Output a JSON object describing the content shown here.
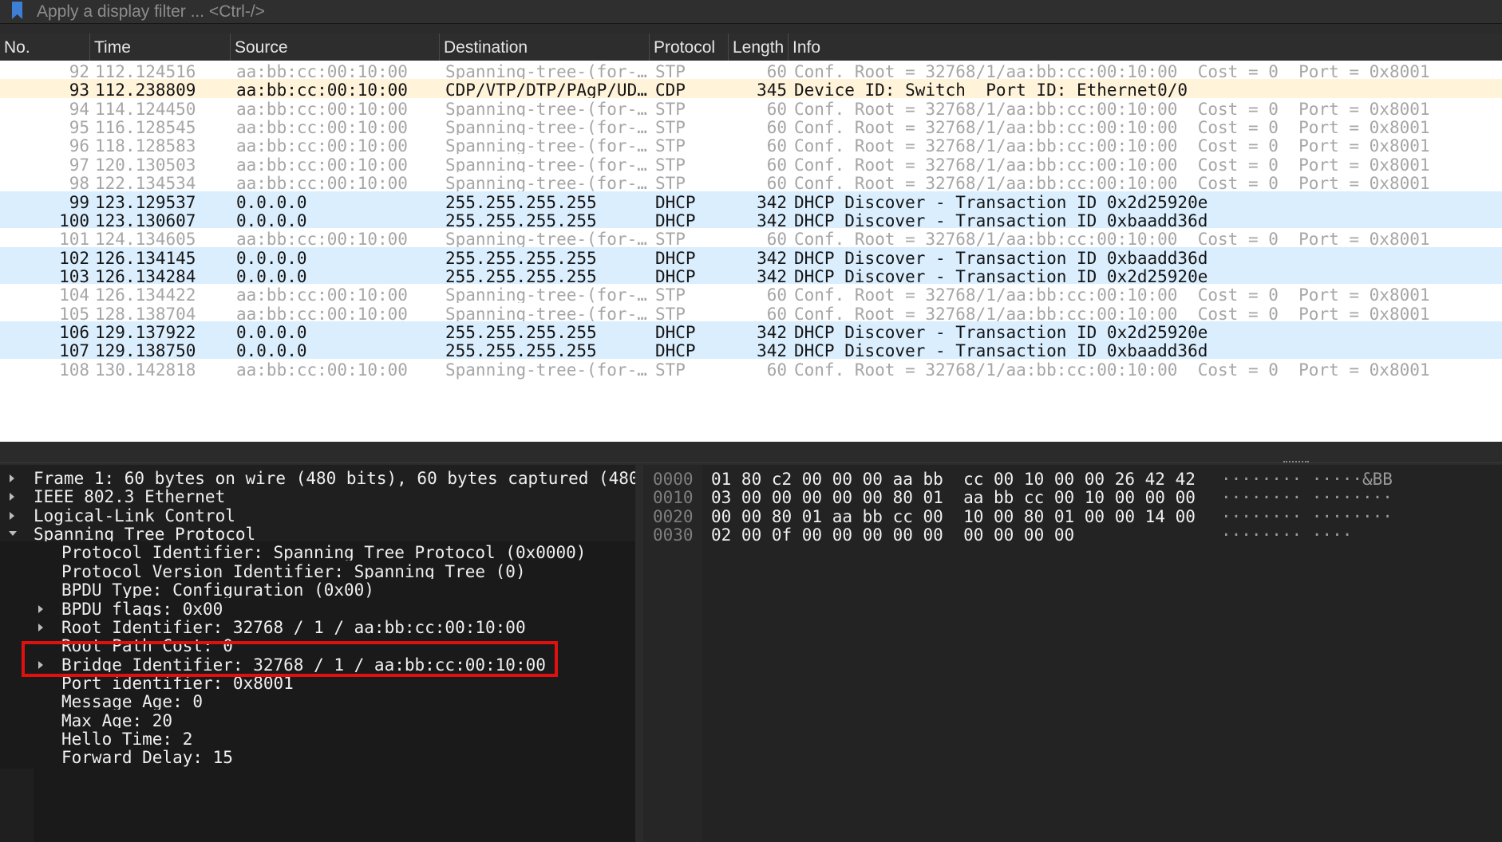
{
  "filter": {
    "placeholder": "Apply a display filter ... <Ctrl-/>"
  },
  "packet_list": {
    "columns": [
      "No.",
      "Time",
      "Source",
      "Destination",
      "Protocol",
      "Length",
      "Info"
    ],
    "rows": [
      {
        "no": "92",
        "time": "112.124516",
        "src": "aa:bb:cc:00:10:00",
        "dst": "Spanning-tree-(for-…",
        "proto": "STP",
        "len": "60",
        "info": "Conf. Root = 32768/1/aa:bb:cc:00:10:00  Cost = 0  Port = 0x8001",
        "kind": "stp"
      },
      {
        "no": "93",
        "time": "112.238809",
        "src": "aa:bb:cc:00:10:00",
        "dst": "CDP/VTP/DTP/PAgP/UD…",
        "proto": "CDP",
        "len": "345",
        "info": "Device ID: Switch  Port ID: Ethernet0/0",
        "kind": "cdp"
      },
      {
        "no": "94",
        "time": "114.124450",
        "src": "aa:bb:cc:00:10:00",
        "dst": "Spanning-tree-(for-…",
        "proto": "STP",
        "len": "60",
        "info": "Conf. Root = 32768/1/aa:bb:cc:00:10:00  Cost = 0  Port = 0x8001",
        "kind": "stp"
      },
      {
        "no": "95",
        "time": "116.128545",
        "src": "aa:bb:cc:00:10:00",
        "dst": "Spanning-tree-(for-…",
        "proto": "STP",
        "len": "60",
        "info": "Conf. Root = 32768/1/aa:bb:cc:00:10:00  Cost = 0  Port = 0x8001",
        "kind": "stp"
      },
      {
        "no": "96",
        "time": "118.128583",
        "src": "aa:bb:cc:00:10:00",
        "dst": "Spanning-tree-(for-…",
        "proto": "STP",
        "len": "60",
        "info": "Conf. Root = 32768/1/aa:bb:cc:00:10:00  Cost = 0  Port = 0x8001",
        "kind": "stp"
      },
      {
        "no": "97",
        "time": "120.130503",
        "src": "aa:bb:cc:00:10:00",
        "dst": "Spanning-tree-(for-…",
        "proto": "STP",
        "len": "60",
        "info": "Conf. Root = 32768/1/aa:bb:cc:00:10:00  Cost = 0  Port = 0x8001",
        "kind": "stp"
      },
      {
        "no": "98",
        "time": "122.134534",
        "src": "aa:bb:cc:00:10:00",
        "dst": "Spanning-tree-(for-…",
        "proto": "STP",
        "len": "60",
        "info": "Conf. Root = 32768/1/aa:bb:cc:00:10:00  Cost = 0  Port = 0x8001",
        "kind": "stp"
      },
      {
        "no": "99",
        "time": "123.129537",
        "src": "0.0.0.0",
        "dst": "255.255.255.255",
        "proto": "DHCP",
        "len": "342",
        "info": "DHCP Discover - Transaction ID 0x2d25920e",
        "kind": "dhcp"
      },
      {
        "no": "100",
        "time": "123.130607",
        "src": "0.0.0.0",
        "dst": "255.255.255.255",
        "proto": "DHCP",
        "len": "342",
        "info": "DHCP Discover - Transaction ID 0xbaadd36d",
        "kind": "dhcp"
      },
      {
        "no": "101",
        "time": "124.134605",
        "src": "aa:bb:cc:00:10:00",
        "dst": "Spanning-tree-(for-…",
        "proto": "STP",
        "len": "60",
        "info": "Conf. Root = 32768/1/aa:bb:cc:00:10:00  Cost = 0  Port = 0x8001",
        "kind": "stp"
      },
      {
        "no": "102",
        "time": "126.134145",
        "src": "0.0.0.0",
        "dst": "255.255.255.255",
        "proto": "DHCP",
        "len": "342",
        "info": "DHCP Discover - Transaction ID 0xbaadd36d",
        "kind": "dhcp"
      },
      {
        "no": "103",
        "time": "126.134284",
        "src": "0.0.0.0",
        "dst": "255.255.255.255",
        "proto": "DHCP",
        "len": "342",
        "info": "DHCP Discover - Transaction ID 0x2d25920e",
        "kind": "dhcp"
      },
      {
        "no": "104",
        "time": "126.134422",
        "src": "aa:bb:cc:00:10:00",
        "dst": "Spanning-tree-(for-…",
        "proto": "STP",
        "len": "60",
        "info": "Conf. Root = 32768/1/aa:bb:cc:00:10:00  Cost = 0  Port = 0x8001",
        "kind": "stp"
      },
      {
        "no": "105",
        "time": "128.138704",
        "src": "aa:bb:cc:00:10:00",
        "dst": "Spanning-tree-(for-…",
        "proto": "STP",
        "len": "60",
        "info": "Conf. Root = 32768/1/aa:bb:cc:00:10:00  Cost = 0  Port = 0x8001",
        "kind": "stp"
      },
      {
        "no": "106",
        "time": "129.137922",
        "src": "0.0.0.0",
        "dst": "255.255.255.255",
        "proto": "DHCP",
        "len": "342",
        "info": "DHCP Discover - Transaction ID 0x2d25920e",
        "kind": "dhcp"
      },
      {
        "no": "107",
        "time": "129.138750",
        "src": "0.0.0.0",
        "dst": "255.255.255.255",
        "proto": "DHCP",
        "len": "342",
        "info": "DHCP Discover - Transaction ID 0xbaadd36d",
        "kind": "dhcp"
      },
      {
        "no": "108",
        "time": "130.142818",
        "src": "aa:bb:cc:00:10:00",
        "dst": "Spanning-tree-(for-…",
        "proto": "STP",
        "len": "60",
        "info": "Conf. Root = 32768/1/aa:bb:cc:00:10:00  Cost = 0  Port = 0x8001",
        "kind": "stp"
      }
    ]
  },
  "details": {
    "items": [
      {
        "label": "Frame 1: 60 bytes on wire (480 bits), 60 bytes captured (480",
        "level": 0,
        "expander": "collapsed"
      },
      {
        "label": "IEEE 802.3 Ethernet",
        "level": 0,
        "expander": "collapsed"
      },
      {
        "label": "Logical-Link Control",
        "level": 0,
        "expander": "collapsed"
      },
      {
        "label": "Spanning Tree Protocol",
        "level": 0,
        "expander": "expanded"
      },
      {
        "label": "Protocol Identifier: Spanning Tree Protocol (0x0000)",
        "level": 1,
        "expander": "none"
      },
      {
        "label": "Protocol Version Identifier: Spanning Tree (0)",
        "level": 1,
        "expander": "none"
      },
      {
        "label": "BPDU Type: Configuration (0x00)",
        "level": 1,
        "expander": "none"
      },
      {
        "label": "BPDU flags: 0x00",
        "level": 1,
        "expander": "collapsed"
      },
      {
        "label": "Root Identifier: 32768 / 1 / aa:bb:cc:00:10:00",
        "level": 1,
        "expander": "collapsed",
        "highlighted": true
      },
      {
        "label": "Root Path Cost: 0",
        "level": 1,
        "expander": "none"
      },
      {
        "label": "Bridge Identifier: 32768 / 1 / aa:bb:cc:00:10:00",
        "level": 1,
        "expander": "collapsed"
      },
      {
        "label": "Port identifier: 0x8001",
        "level": 1,
        "expander": "none"
      },
      {
        "label": "Message Age: 0",
        "level": 1,
        "expander": "none"
      },
      {
        "label": "Max Age: 20",
        "level": 1,
        "expander": "none"
      },
      {
        "label": "Hello Time: 2",
        "level": 1,
        "expander": "none"
      },
      {
        "label": "Forward Delay: 15",
        "level": 1,
        "expander": "none"
      }
    ]
  },
  "hex": {
    "rows": [
      {
        "offset": "0000",
        "bytes": "01 80 c2 00 00 00 aa bb  cc 00 10 00 00 26 42 42",
        "ascii": "········ ·····&BB"
      },
      {
        "offset": "0010",
        "bytes": "03 00 00 00 00 00 80 01  aa bb cc 00 10 00 00 00",
        "ascii": "········ ········"
      },
      {
        "offset": "0020",
        "bytes": "00 00 80 01 aa bb cc 00  10 00 80 01 00 00 14 00",
        "ascii": "········ ········"
      },
      {
        "offset": "0030",
        "bytes": "02 00 0f 00 00 00 00 00  00 00 00 00",
        "ascii": "········ ····"
      }
    ]
  },
  "colors": {
    "stp_row_bg": "#ffffff",
    "stp_row_fg": "#a6a6a6",
    "cdp_row_bg": "#fff3da",
    "dhcp_row_bg": "#daeefe",
    "bookmark": "#3d7fd6",
    "highlight": "#e01010"
  },
  "icons": {
    "bookmark": "bookmark-icon",
    "collapsed": "triangle-right-icon",
    "expanded": "triangle-down-icon"
  }
}
